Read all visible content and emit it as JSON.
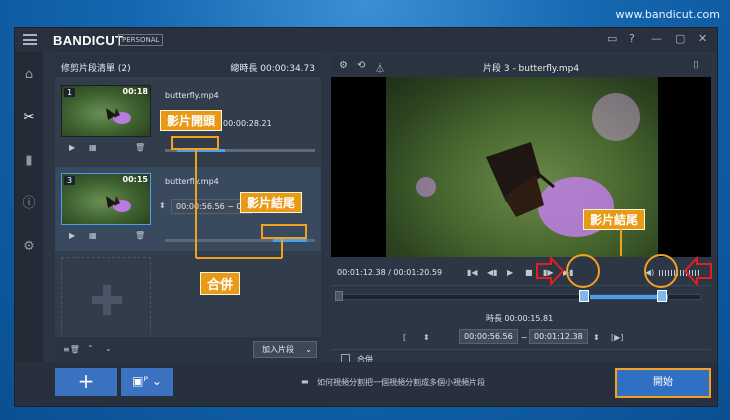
{
  "watermark": "www.bandicut.com",
  "app": {
    "name": "BANDICUT",
    "edition": "PERSONAL"
  },
  "left_panel": {
    "title": "修剪片段清單 (2)",
    "total_label": "總時長 00:00:34.73",
    "clips": [
      {
        "num": "1",
        "duration": "00:18",
        "filename": "butterfly.mp4",
        "time": "00:00:28.21"
      },
      {
        "num": "3",
        "duration": "00:15",
        "filename": "butterfly.mp4",
        "time": "00:00:56.56 ~ 00"
      }
    ],
    "add_segment": "加入片段"
  },
  "callouts": {
    "start": "影片開頭",
    "end_left": "影片結尾",
    "merge": "合併",
    "end_right": "影片結尾"
  },
  "right_panel": {
    "title": "片段 3 - butterfly.mp4",
    "current_time": "00:01:12.38 / 00:01:20.59",
    "duration_label": "時長 00:00:15.81",
    "start_time": "00:00:56.56",
    "end_time": "00:01:12.38",
    "tilde": "~",
    "merge_label": "合併"
  },
  "footer": {
    "hint": "如何視頻分割把一個視頻分割成多個小視頻片段",
    "start_button": "開始"
  }
}
